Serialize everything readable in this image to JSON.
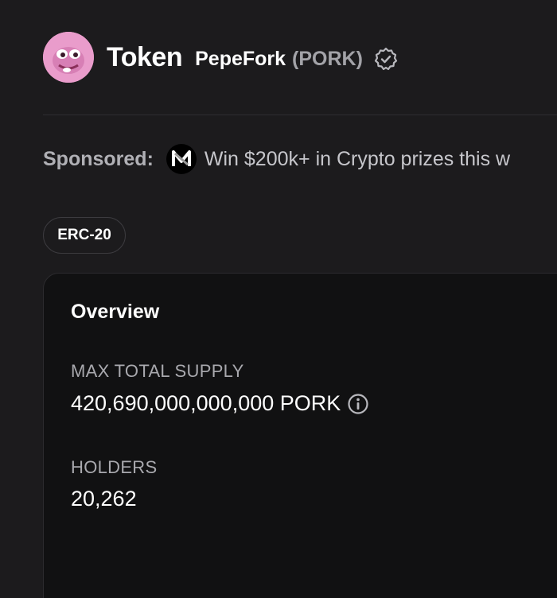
{
  "header": {
    "title": "Token",
    "token_name": "PepeFork",
    "token_symbol": "(PORK)",
    "avatar_icon": "pepe-avatar-icon",
    "verified_icon": "verified-badge-icon"
  },
  "sponsored": {
    "label": "Sponsored:",
    "logo_icon": "sponsor-logo-icon",
    "text": "Win $200k+ in Crypto prizes this w"
  },
  "standard_badge": "ERC-20",
  "overview": {
    "title": "Overview",
    "max_supply_label": "MAX TOTAL SUPPLY",
    "max_supply_value": "420,690,000,000,000 PORK",
    "info_icon": "info-icon",
    "holders_label": "HOLDERS",
    "holders_value": "20,262"
  },
  "colors": {
    "background": "#1c1b1d",
    "card_background": "#111112",
    "avatar_background": "#e99ccb",
    "muted_text": "#a3a3a8"
  }
}
